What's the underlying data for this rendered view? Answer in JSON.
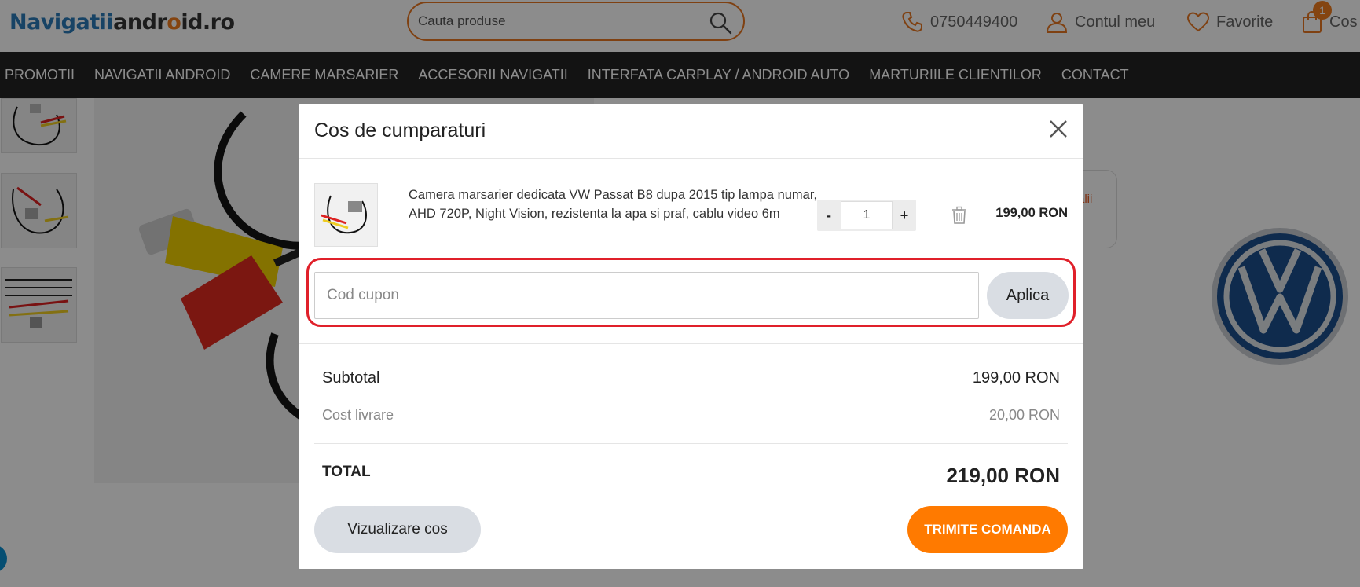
{
  "header": {
    "logo": {
      "part1": "N",
      "part2": "avigatii",
      "part3": "andr",
      "part4": "o",
      "part5": "id.ro"
    },
    "search_placeholder": "Cauta produse",
    "phone": "0750449400",
    "account": "Contul meu",
    "favorites": "Favorite",
    "cart_label": "Cos",
    "cart_count": "1"
  },
  "nav": [
    "PROMOTII",
    "NAVIGATII ANDROID",
    "CAMERE MARSARIER",
    "ACCESORII NAVIGATII",
    "INTERFATA CARPLAY / ANDROID AUTO",
    "MARTURIILE CLIENTILOR",
    "CONTACT"
  ],
  "background": {
    "side_text_1": "alii",
    "side_text_2": "i"
  },
  "colors": {
    "accent": "#ff7a00",
    "brand_blue": "#2a7ab8",
    "highlight": "#e0202a"
  },
  "modal": {
    "title": "Cos de cumparaturi",
    "item": {
      "name": "Camera marsarier dedicata VW Passat B8 dupa 2015 tip lampa numar, AHD 720P, Night Vision, rezistenta la apa si praf, cablu video 6m",
      "minus": "-",
      "plus": "+",
      "quantity": "1",
      "price": "199,00 RON"
    },
    "coupon": {
      "placeholder": "Cod cupon",
      "apply_label": "Aplica"
    },
    "summary": {
      "subtotal_label": "Subtotal",
      "subtotal_value": "199,00 RON",
      "shipping_label": "Cost livrare",
      "shipping_value": "20,00 RON",
      "total_label": "TOTAL",
      "total_value": "219,00 RON"
    },
    "view_cart_label": "Vizualizare cos",
    "send_order_label": "TRIMITE COMANDA"
  }
}
